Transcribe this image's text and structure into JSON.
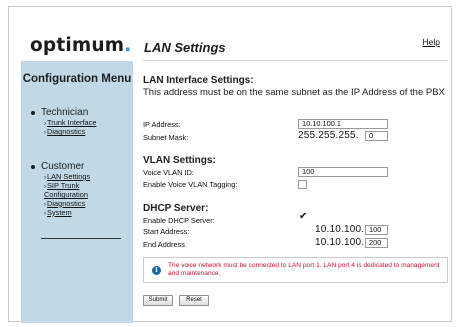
{
  "brand": {
    "name": "optimum",
    "dot": "."
  },
  "header": {
    "title": "LAN Settings",
    "help": "Help"
  },
  "sidebar": {
    "title": "Configuration Menu",
    "groups": [
      {
        "label": "Technician",
        "items": [
          "Trunk Interface",
          "Diagnostics"
        ]
      },
      {
        "label": "Customer",
        "items": [
          "LAN Settings",
          "SIP Trunk Configuration",
          "Diagnostics",
          "System"
        ]
      }
    ]
  },
  "lan": {
    "heading": "LAN Interface Settings:",
    "description": "This address must be on the same subnet as the IP Address of the PBX",
    "ip_label": "IP Address:",
    "ip_value": "10.10.100.1",
    "mask_label": "Subnet Mask:",
    "mask_prefix": "255.255.255.",
    "mask_value": "0"
  },
  "vlan": {
    "heading": "VLAN Settings:",
    "id_label": "Voice VLAN ID:",
    "id_value": "100",
    "tag_label": "Enable Voice VLAN Tagging:",
    "tag_checked": false
  },
  "dhcp": {
    "heading": "DHCP Server:",
    "enable_label": "Enable DHCP Server:",
    "enabled": true,
    "start_label": "Start Address:",
    "start_prefix": "10.10.100.",
    "start_value": "100",
    "end_label": "End Address",
    "end_prefix": "10.10.100.",
    "end_value": "200"
  },
  "note": {
    "text": "The voice network must be connected to LAN port 1. LAN port 4 is dedicated to management and maintenance.",
    "color": "#c8102e"
  },
  "buttons": {
    "submit": "Submit",
    "reset": "Reset"
  },
  "colors": {
    "sidebar_bg": "#c1d9e7",
    "brand_dot": "#1b9ad6",
    "info_icon": "#1b6aa5"
  },
  "icons": {
    "info": "info-icon",
    "check": "checkmark-icon"
  }
}
